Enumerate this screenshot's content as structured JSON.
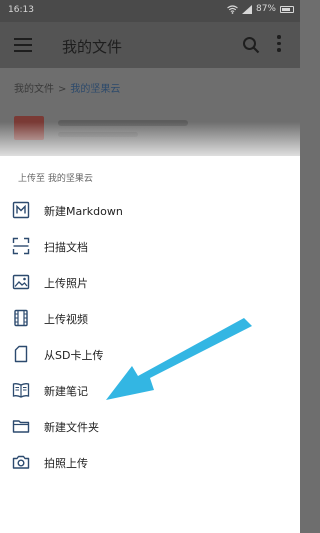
{
  "status": {
    "time": "16:13",
    "battery": "87%"
  },
  "app_bar": {
    "title": "我的文件"
  },
  "breadcrumb": {
    "root": "我的文件",
    "separator": ">",
    "current": "我的坚果云"
  },
  "sheet": {
    "header": "上传至 我的坚果云",
    "items": [
      {
        "label": "新建Markdown",
        "icon": "markdown-icon"
      },
      {
        "label": "扫描文档",
        "icon": "scan-icon"
      },
      {
        "label": "上传照片",
        "icon": "image-icon"
      },
      {
        "label": "上传视频",
        "icon": "film-icon"
      },
      {
        "label": "从SD卡上传",
        "icon": "sd-card-icon"
      },
      {
        "label": "新建笔记",
        "icon": "notebook-icon"
      },
      {
        "label": "新建文件夹",
        "icon": "folder-icon"
      },
      {
        "label": "拍照上传",
        "icon": "camera-icon"
      }
    ]
  },
  "colors": {
    "icon": "#2c4a6e",
    "annotation_arrow": "#33b6e3",
    "background_dim": "#6e6e6e"
  }
}
